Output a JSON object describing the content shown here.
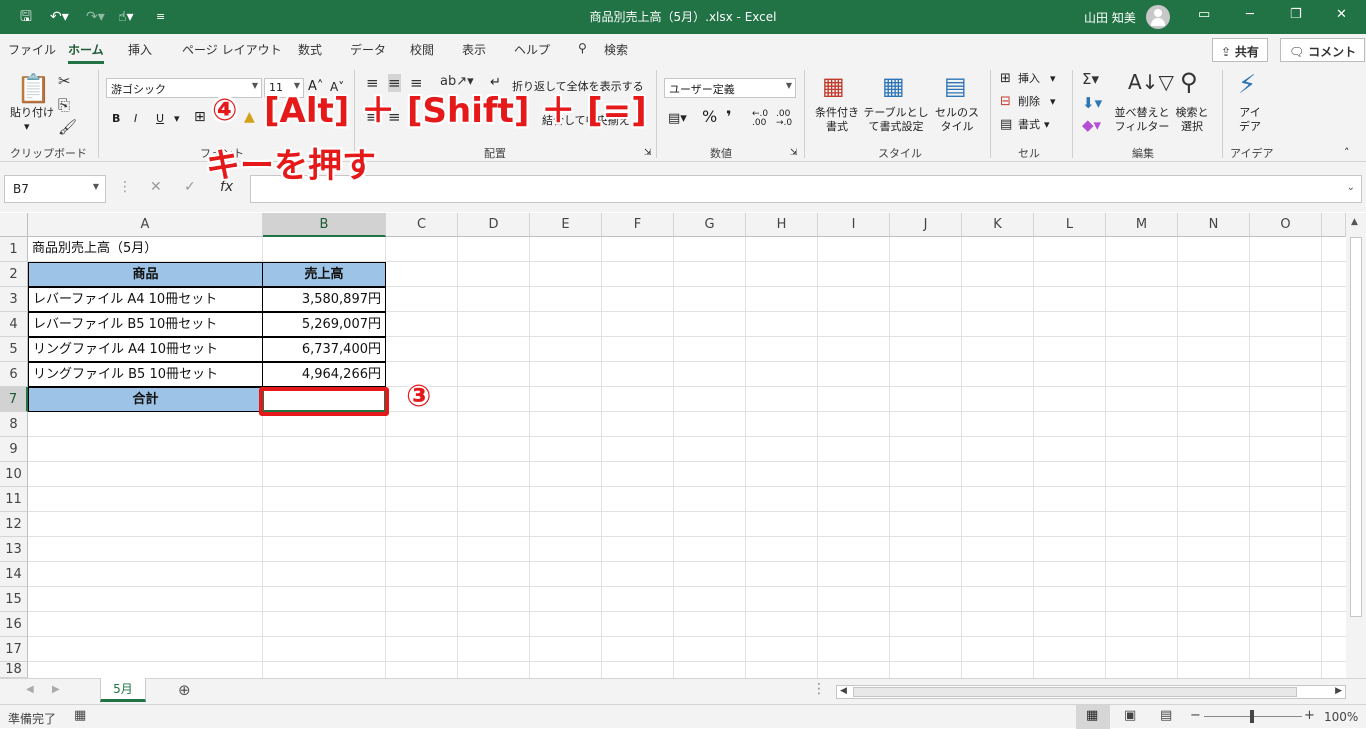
{
  "titlebar": {
    "title": "商品別売上高（5月）.xlsx  -  Excel",
    "user": "山田 知美"
  },
  "menu": {
    "items": [
      "ファイル",
      "ホーム",
      "挿入",
      "ページ レイアウト",
      "数式",
      "データ",
      "校閲",
      "表示",
      "ヘルプ",
      "検索"
    ],
    "share": "共有",
    "comment": "コメント"
  },
  "ribbon": {
    "paste": "貼り付け",
    "clipboard": "クリップボード",
    "font_name": "游ゴシック",
    "font_size": "11",
    "font_group": "フォント",
    "wrap_text": "折り返して全体を表示する",
    "merge_center": "結合して中央揃え",
    "align_group": "配置",
    "number_format": "ユーザー定義",
    "number_group": "数値",
    "cond_format": "条件付き書式",
    "table_format": "テーブルとして書式設定",
    "cell_styles": "セルのスタイル",
    "styles_group": "スタイル",
    "insert": "挿入",
    "delete": "削除",
    "format": "書式",
    "cells_group": "セル",
    "sort_filter": "並べ替えとフィルター",
    "find_select": "検索と選択",
    "edit_group": "編集",
    "ideas": "アイデア",
    "ideas_group": "アイデア"
  },
  "formula": {
    "namebox": "B7",
    "value": ""
  },
  "columns": [
    "A",
    "B",
    "C",
    "D",
    "E",
    "F",
    "G",
    "H",
    "I",
    "J",
    "K",
    "L",
    "M",
    "N",
    "O"
  ],
  "rows": [
    "1",
    "2",
    "3",
    "4",
    "5",
    "6",
    "7",
    "8",
    "9",
    "10",
    "11",
    "12",
    "13",
    "14",
    "15",
    "16",
    "17",
    "18"
  ],
  "sheet": {
    "title": "商品別売上高（5月）",
    "header_product": "商品",
    "header_sales": "売上高",
    "items": [
      {
        "name": "レバーファイル A4 10冊セット",
        "sales": "3,580,897円"
      },
      {
        "name": "レバーファイル B5 10冊セット",
        "sales": "5,269,007円"
      },
      {
        "name": "リングファイル A4 10冊セット",
        "sales": "6,737,400円"
      },
      {
        "name": "リングファイル B5 10冊セット",
        "sales": "4,964,266円"
      }
    ],
    "total_label": "合計"
  },
  "sheet_tab": "5月",
  "status": {
    "ready": "準備完了",
    "zoom": "100%"
  },
  "annotations": {
    "step3": "③",
    "step4": "④",
    "keys": "[Alt] ＋ [Shift] ＋ [=]",
    "keys_line2": "キーを押す"
  },
  "colors": {
    "excel_green": "#217346",
    "header_fill": "#9dc3e6",
    "annotation_red": "#e51919"
  }
}
